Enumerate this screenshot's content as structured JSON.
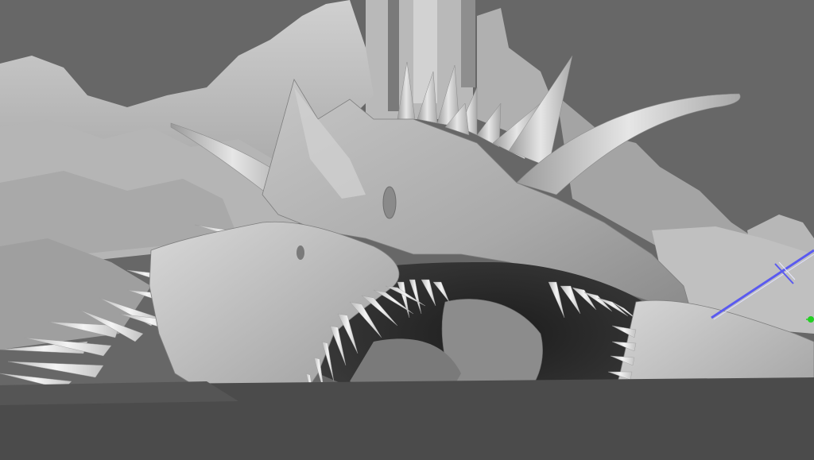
{
  "viewport": {
    "name": "",
    "shading": "smooth-shaded-gray",
    "subject": "dragon-head-sculpt",
    "background_color": "#676767",
    "ground_color": "#4b4b4b",
    "model_color": "#bdbdbd",
    "selection_color": "#5a5af0",
    "gizmo_color": "#22d022"
  }
}
